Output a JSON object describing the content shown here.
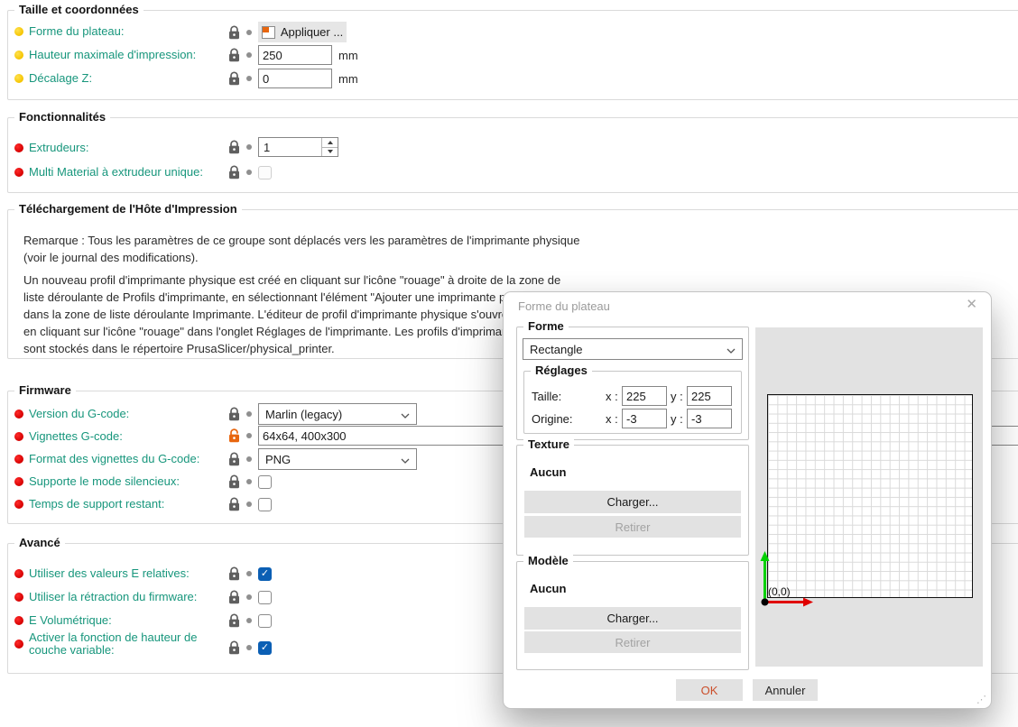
{
  "colors": {
    "label_teal": "#17967c",
    "bullet_red": "#d40000",
    "bullet_yellow": "#f5c400",
    "checkbox_blue": "#0b5fb4",
    "lock_gray": "#5f5f5f",
    "lock_orange": "#e8660f",
    "ok_text": "#cb4e2a"
  },
  "sections": {
    "coords": {
      "title": "Taille et coordonnées",
      "rows": [
        {
          "label": "Forme du plateau:",
          "button": "Appliquer ..."
        },
        {
          "label": "Hauteur maximale d'impression:",
          "value": "250",
          "unit": "mm"
        },
        {
          "label": "Décalage Z:",
          "value": "0",
          "unit": "mm"
        }
      ]
    },
    "features": {
      "title": "Fonctionnalités",
      "rows": [
        {
          "label": "Extrudeurs:",
          "value": "1"
        },
        {
          "label": "Multi Material à extrudeur unique:"
        }
      ]
    },
    "host": {
      "title": "Téléchargement de l'Hôte d'Impression",
      "note_lines": [
        "Remarque : Tous les paramètres de ce groupe sont déplacés vers les paramètres de l'imprimante physique",
        "(voir le journal des modifications)."
      ],
      "para_lines": [
        "Un nouveau profil d'imprimante physique est créé en cliquant sur l'icône \"rouage\" à droite de la zone de",
        "liste déroulante de Profils d'imprimante, en sélectionnant l'élément \"Ajouter une imprimante physique\"",
        "dans la zone de liste déroulante Imprimante. L'éditeur de profil d'imprimante physique s'ouvre également",
        "en cliquant sur l'icône \"rouage\" dans l'onglet Réglages de l'imprimante. Les profils d'imprimante physique",
        "sont stockés dans le répertoire PrusaSlicer/physical_printer."
      ]
    },
    "firmware": {
      "title": "Firmware",
      "rows": [
        {
          "label": "Version du G-code:",
          "value": "Marlin (legacy)"
        },
        {
          "label": "Vignettes G-code:",
          "value": "64x64, 400x300"
        },
        {
          "label": "Format des vignettes du G-code:",
          "value": "PNG"
        },
        {
          "label": "Supporte le mode silencieux:"
        },
        {
          "label": "Temps de support restant:"
        }
      ]
    },
    "advanced": {
      "title": "Avancé",
      "rows": [
        {
          "label": "Utiliser des valeurs E relatives:",
          "checked": true
        },
        {
          "label": "Utiliser la rétraction du firmware:",
          "checked": false
        },
        {
          "label": "E Volumétrique:",
          "checked": false
        },
        {
          "label": "Activer la fonction de hauteur de\ncouche variable:",
          "checked": true
        }
      ]
    }
  },
  "dialog": {
    "title": "Forme du plateau",
    "shape_group": {
      "title": "Forme",
      "selected": "Rectangle"
    },
    "settings_group": {
      "title": "Réglages",
      "size_label": "Taille:",
      "origin_label": "Origine:",
      "x_label": "x :",
      "y_label": "y :",
      "size_x": "225",
      "size_y": "225",
      "origin_x": "-3",
      "origin_y": "-3"
    },
    "texture_group": {
      "title": "Texture",
      "none": "Aucun",
      "load": "Charger...",
      "remove": "Retirer"
    },
    "model_group": {
      "title": "Modèle",
      "none": "Aucun",
      "load": "Charger...",
      "remove": "Retirer"
    },
    "preview": {
      "origin_label": "(0,0)"
    },
    "ok": "OK",
    "cancel": "Annuler"
  }
}
